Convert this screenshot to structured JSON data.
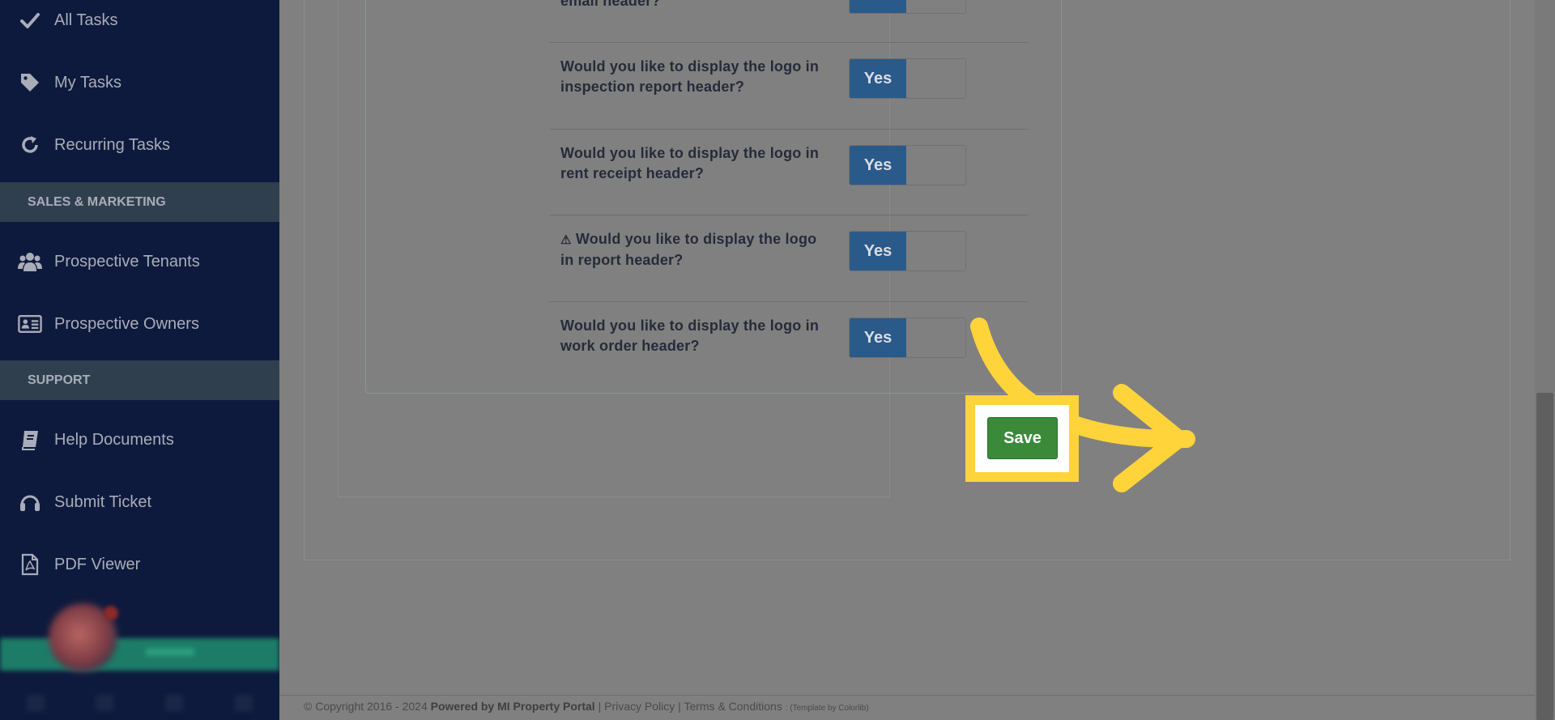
{
  "sidebar": {
    "items": [
      {
        "label": "All Tasks",
        "icon": "check-icon"
      },
      {
        "label": "My Tasks",
        "icon": "tag-icon"
      },
      {
        "label": "Recurring Tasks",
        "icon": "refresh-icon"
      },
      {
        "label": "Prospective Tenants",
        "icon": "users-icon"
      },
      {
        "label": "Prospective Owners",
        "icon": "id-card-icon"
      },
      {
        "label": "Help Documents",
        "icon": "book-icon"
      },
      {
        "label": "Submit Ticket",
        "icon": "headset-icon"
      },
      {
        "label": "PDF Viewer",
        "icon": "pdf-file-icon"
      }
    ],
    "sections": {
      "sales_marketing": "SALES & MARKETING",
      "support": "SUPPORT"
    }
  },
  "settings": {
    "partial_question": "email header?",
    "rows": [
      {
        "question": "Would you like to display the logo in inspection report header?",
        "toggle": "Yes"
      },
      {
        "question": "Would you like to display the logo in rent receipt header?",
        "toggle": "Yes"
      },
      {
        "question": "Would you like to display the logo in report header?",
        "toggle": "Yes",
        "warning_icon": "warning-icon"
      },
      {
        "question": "Would you like to display the logo in work order header?",
        "toggle": "Yes"
      }
    ],
    "save_label": "Save"
  },
  "footer": {
    "copyright": "© Copyright 2016 - 2024",
    "powered_by": "Powered by MI Property Portal",
    "sep1": "|",
    "privacy": "Privacy Policy",
    "sep2": "|",
    "terms": "Terms & Conditions",
    "template_credit": ": (Template by Colorlib)"
  },
  "colors": {
    "sidebar_bg": "#0e1a3d",
    "toggle_yes": "#2a5a8a",
    "save_button": "#3a8a3a",
    "highlight": "#ffd33a"
  }
}
